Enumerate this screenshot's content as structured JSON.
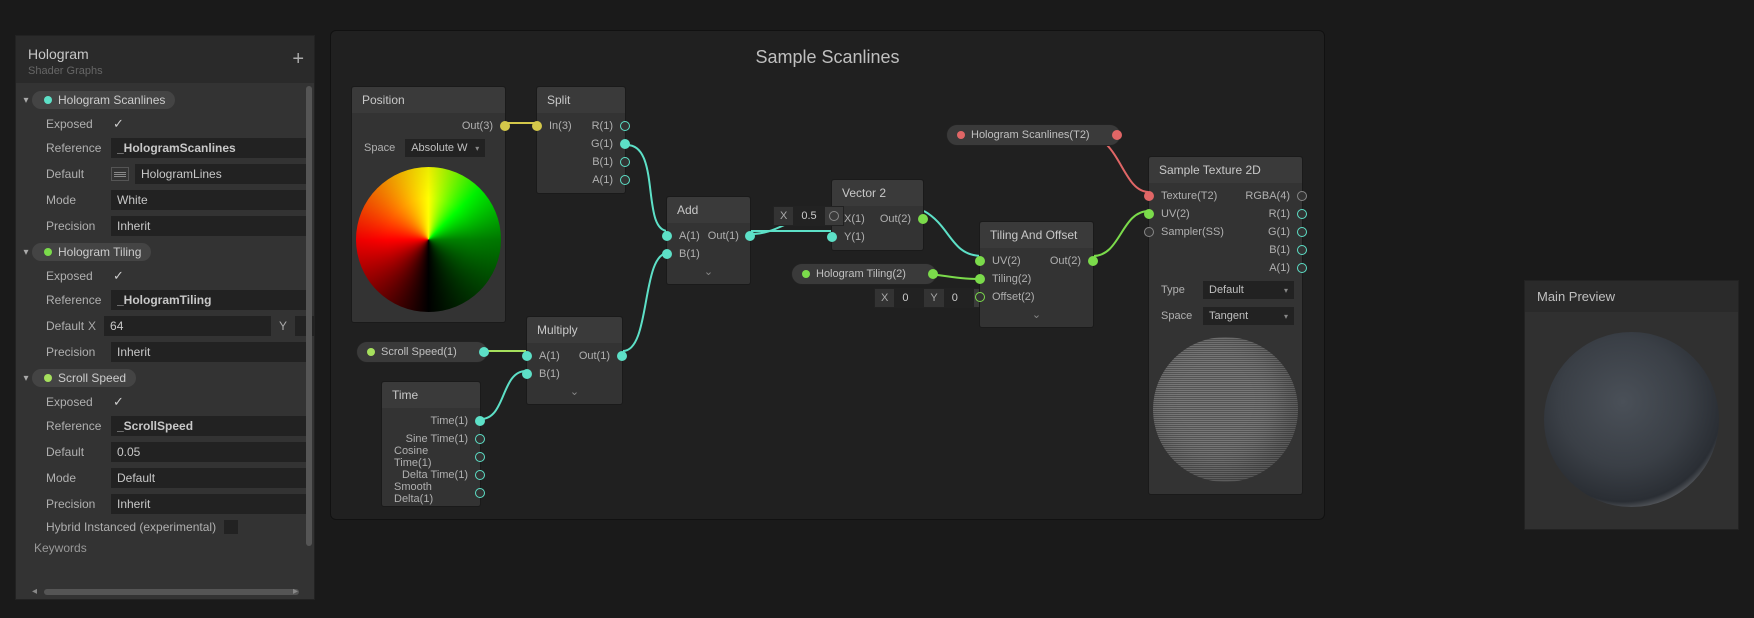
{
  "inspector": {
    "title": "Hologram",
    "subtitle": "Shader Graphs",
    "keywords_label": "Keywords",
    "properties": [
      {
        "name": "Hologram Scanlines",
        "dot_color": "teal",
        "exposed_label": "Exposed",
        "exposed": true,
        "reference_label": "Reference",
        "reference": "_HologramScanlines",
        "default_label": "Default",
        "default": "HologramLines",
        "default_type": "texture",
        "mode_label": "Mode",
        "mode": "White",
        "precision_label": "Precision",
        "precision": "Inherit"
      },
      {
        "name": "Hologram Tiling",
        "dot_color": "green",
        "exposed_label": "Exposed",
        "exposed": true,
        "reference_label": "Reference",
        "reference": "_HologramTiling",
        "default_label": "Default",
        "default_x_label": "X",
        "default_x": "64",
        "default_y_label": "Y",
        "precision_label": "Precision",
        "precision": "Inherit"
      },
      {
        "name": "Scroll Speed",
        "dot_color": "lime",
        "exposed_label": "Exposed",
        "exposed": true,
        "reference_label": "Reference",
        "reference": "_ScrollSpeed",
        "default_label": "Default",
        "default": "0.05",
        "mode_label": "Mode",
        "mode": "Default",
        "precision_label": "Precision",
        "precision": "Inherit",
        "hybrid_label": "Hybrid Instanced (experimental)"
      }
    ]
  },
  "graph": {
    "title": "Sample Scanlines",
    "nodes": {
      "position": {
        "title": "Position",
        "out": "Out(3)",
        "space_label": "Space",
        "space": "Absolute W"
      },
      "split": {
        "title": "Split",
        "in": "In(3)",
        "r": "R(1)",
        "g": "G(1)",
        "b": "B(1)",
        "a": "A(1)"
      },
      "add": {
        "title": "Add",
        "a": "A(1)",
        "b": "B(1)",
        "out": "Out(1)"
      },
      "multiply": {
        "title": "Multiply",
        "a": "A(1)",
        "b": "B(1)",
        "out": "Out(1)"
      },
      "time": {
        "title": "Time",
        "time": "Time(1)",
        "sine": "Sine Time(1)",
        "cosine": "Cosine Time(1)",
        "delta": "Delta Time(1)",
        "smooth": "Smooth Delta(1)"
      },
      "vector2": {
        "title": "Vector 2",
        "x": "X(1)",
        "y": "Y(1)",
        "out": "Out(2)"
      },
      "tiling": {
        "title": "Tiling And Offset",
        "uv": "UV(2)",
        "tiling": "Tiling(2)",
        "offset": "Offset(2)",
        "out": "Out(2)"
      },
      "sample": {
        "title": "Sample Texture 2D",
        "texture": "Texture(T2)",
        "uv": "UV(2)",
        "sampler": "Sampler(SS)",
        "rgba": "RGBA(4)",
        "r": "R(1)",
        "g": "G(1)",
        "b": "B(1)",
        "a": "A(1)",
        "type_label": "Type",
        "type": "Default",
        "space_label": "Space",
        "space": "Tangent"
      }
    },
    "chips": {
      "scroll_speed": "Scroll Speed(1)",
      "hologram_scanlines": "Hologram Scanlines(T2)",
      "hologram_tiling": "Hologram Tiling(2)"
    },
    "inline": {
      "half": {
        "x_label": "X",
        "x": "0.5"
      },
      "zero": {
        "x_label": "X",
        "x": "0",
        "y_label": "Y",
        "y": "0"
      }
    }
  },
  "preview": {
    "title": "Main Preview"
  }
}
